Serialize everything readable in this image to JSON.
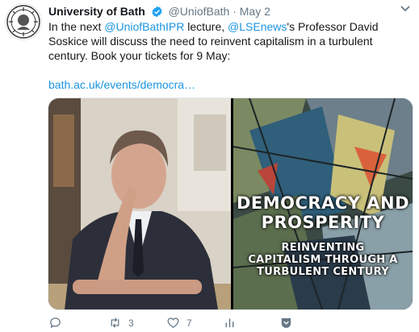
{
  "tweet": {
    "author_name": "University of Bath",
    "handle": "@UniofBath",
    "separator": "·",
    "date": "May 2",
    "text_parts": {
      "p1": "In the next ",
      "mention1": "@UniofBathIPR",
      "p2": " lecture, ",
      "mention2": "@LSEnews",
      "p3": "'s Professor David Soskice will discuss the need to reinvent capitalism in a turbulent century. Book your tickets for 9 May:"
    },
    "link": "bath.ac.uk/events/democra…"
  },
  "poster": {
    "title_line1": "DEMOCRACY AND",
    "title_line2": "PROSPERITY",
    "sub_line1": "REINVENTING",
    "sub_line2": "CAPITALISM THROUGH A",
    "sub_line3": "TURBULENT CENTURY"
  },
  "actions": {
    "reply_icon": "reply-icon",
    "retweet_icon": "retweet-icon",
    "retweet_count": "3",
    "like_icon": "heart-icon",
    "like_count": "7",
    "analytics_icon": "bar-chart-icon",
    "share_icon": "share-icon"
  },
  "colors": {
    "link": "#1b95e0",
    "muted": "#657786",
    "verified": "#1da1f2"
  }
}
